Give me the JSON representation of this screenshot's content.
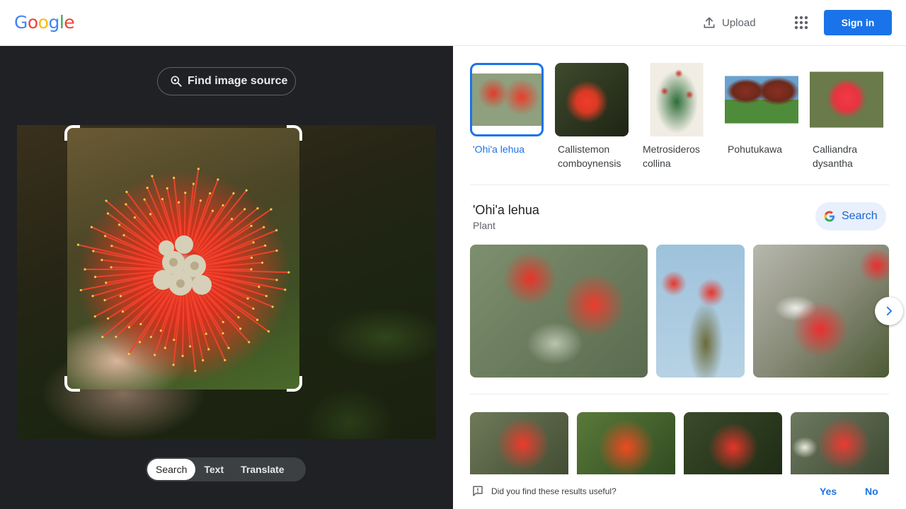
{
  "header": {
    "logo_letters": [
      "G",
      "o",
      "o",
      "g",
      "l",
      "e"
    ],
    "logo_colors": [
      "#4285F4",
      "#EA4335",
      "#FBBC05",
      "#4285F4",
      "#34A853",
      "#EA4335"
    ],
    "upload_label": "Upload",
    "apps_icon": "apps-grid-icon",
    "signin_label": "Sign in",
    "accent_color": "#1a73e8"
  },
  "lens": {
    "find_source_label": "Find image source",
    "modes": [
      {
        "label": "Search",
        "active": true
      },
      {
        "label": "Text",
        "active": false
      },
      {
        "label": "Translate",
        "active": false
      }
    ]
  },
  "entities": [
    {
      "label": "'Ohi'a lehua",
      "selected": true
    },
    {
      "label": "Callistemon comboynensis",
      "selected": false
    },
    {
      "label": "Metrosideros collina",
      "selected": false
    },
    {
      "label": "Pohutukawa",
      "selected": false
    },
    {
      "label": "Calliandra dysantha",
      "selected": false
    }
  ],
  "knowledge": {
    "title": "'Ohi'a lehua",
    "subtitle": "Plant",
    "search_label": "Search"
  },
  "feedback": {
    "question": "Did you find these results useful?",
    "yes": "Yes",
    "no": "No"
  }
}
